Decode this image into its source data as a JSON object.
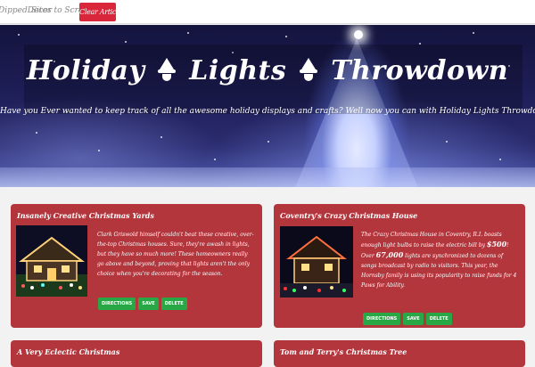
{
  "navbar": {
    "brand": "DippedDecor",
    "sites_dropdown": "Sites to Scrape",
    "clear_button": "Clear Articles"
  },
  "hero": {
    "title_part1": "Holiday",
    "title_part2": "Lights",
    "title_part3": "Throwdown",
    "subtitle": "Have you Ever wanted to keep track of all the awesome holiday displays and crafts? Well now you can with Holiday Lights Throwdown!"
  },
  "articles": [
    {
      "title": "Insanely Creative Christmas Yards",
      "body": "Clark Griswold himself couldn't beat these creative, over-the-top Christmas houses. Sure, they're awash in lights, but they have so much more! These homeowners really go above and beyond, proving that lights aren't the only choice when you're decorating for the season.",
      "buttons": [
        "DIRECTIONS",
        "SAVE",
        "DELETE"
      ]
    },
    {
      "title": "Coventry's Crazy Christmas House",
      "body_pre": "The Crazy Christmas House in Coventry, R.I. boasts enough light bulbs to raise the electric bill by ",
      "body_amount": "$500",
      "body_mid": "! Over ",
      "body_count": "67,000",
      "body_post": " lights are synchronized to dozens of songs broadcast by radio to visitors. This year, the Hornsby family is using its popularity to raise funds for 4 Paws for Ability.",
      "buttons": [
        "DIRECTIONS",
        "SAVE",
        "DELETE"
      ]
    },
    {
      "title": "A Very Eclectic Christmas"
    },
    {
      "title": "Tom and Terry's Christmas Tree"
    }
  ],
  "colors": {
    "card_bg": "#b3363d",
    "button_green": "#28a745",
    "clear_button_red": "#d9263b"
  }
}
